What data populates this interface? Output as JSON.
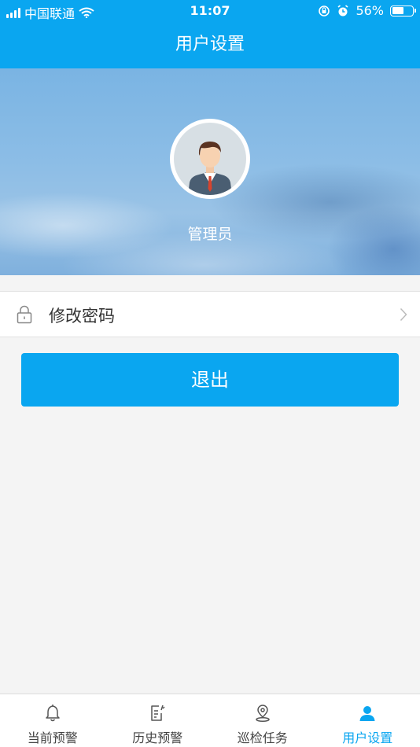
{
  "status_bar": {
    "carrier": "中国联通",
    "time": "11:07",
    "battery": "56%",
    "battery_level": 0.56
  },
  "header": {
    "title": "用户设置"
  },
  "profile": {
    "name": "管理员"
  },
  "menu": {
    "change_password_label": "修改密码"
  },
  "actions": {
    "logout_label": "退出"
  },
  "tabs": [
    {
      "label": "当前预警",
      "icon": "bell-icon"
    },
    {
      "label": "历史预警",
      "icon": "document-icon"
    },
    {
      "label": "巡检任务",
      "icon": "location-pin-icon"
    },
    {
      "label": "用户设置",
      "icon": "user-icon",
      "active": true
    }
  ],
  "colors": {
    "primary": "#0aa6f0",
    "background": "#f4f4f4"
  }
}
